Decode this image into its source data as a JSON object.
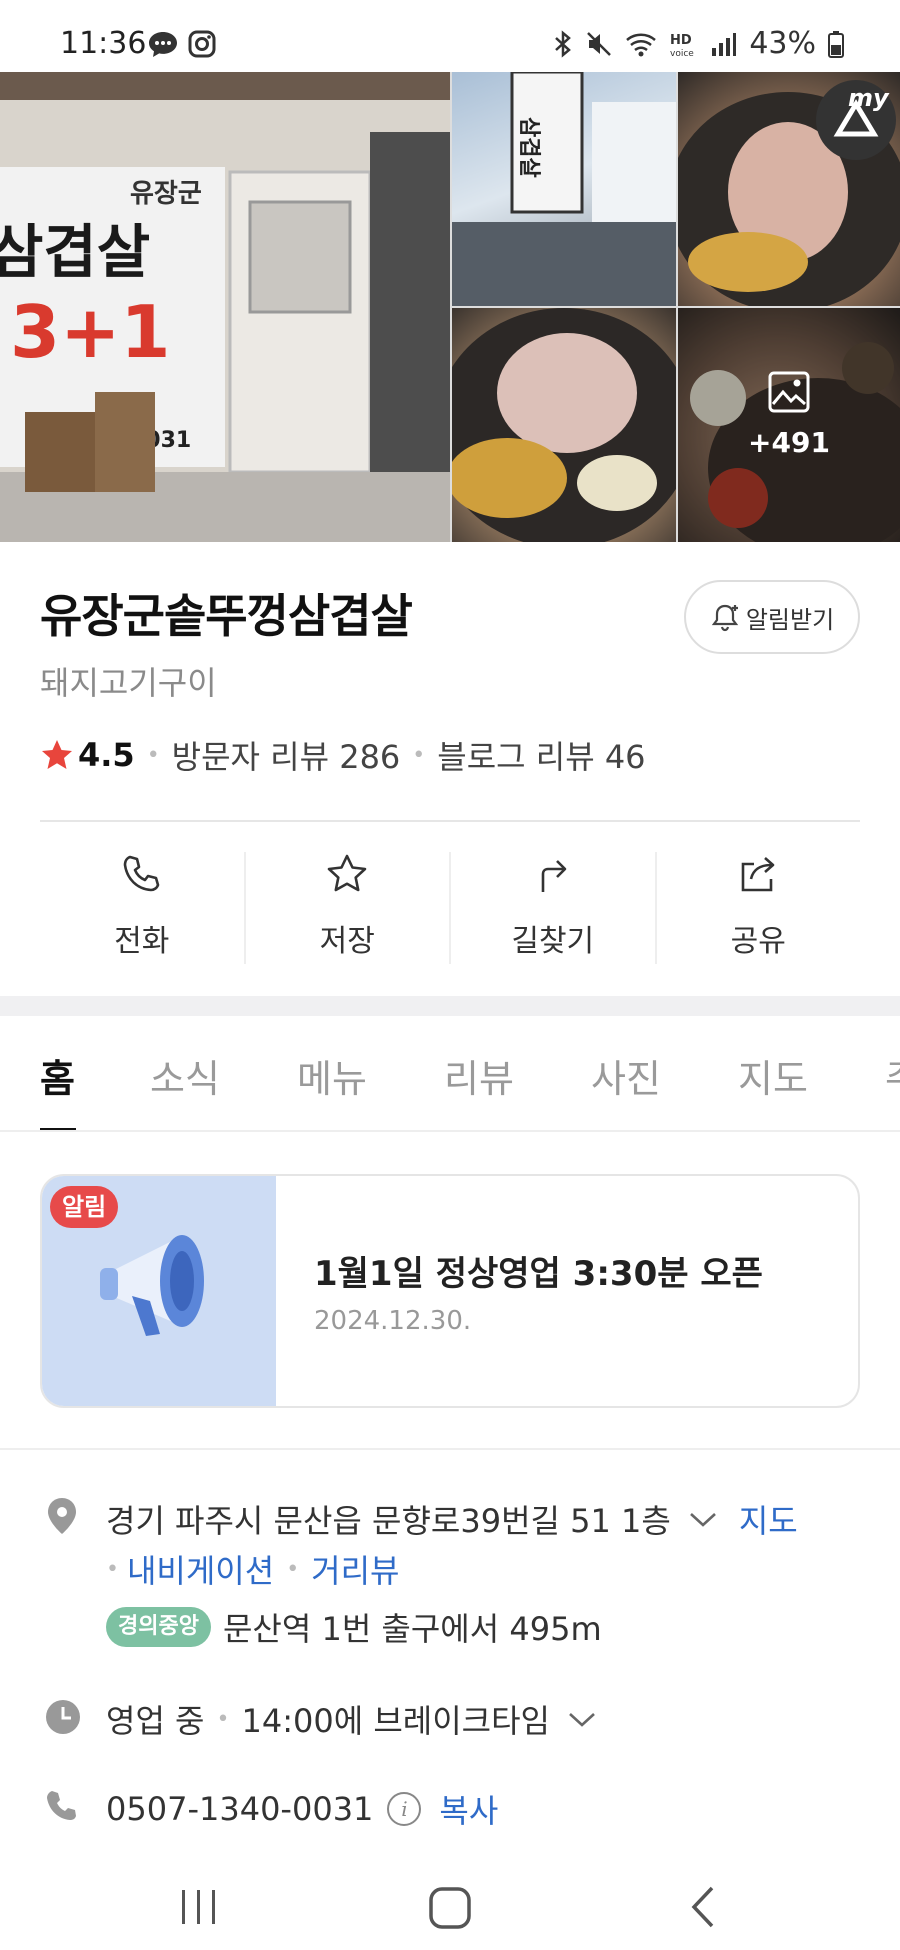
{
  "status_bar": {
    "time": "11:36",
    "battery": "43%",
    "left_icons": [
      "message-icon",
      "instagram-icon"
    ],
    "right_icons": [
      "bluetooth-icon",
      "mute-icon",
      "wifi-icon",
      "hd-voice-icon",
      "signal-icon",
      "battery-icon"
    ]
  },
  "gallery": {
    "main_sign_lines": [
      "유장군",
      "삼겹살",
      "3+1",
      "0031"
    ],
    "tile_sign": "삼겹살",
    "more_count": "+491",
    "badge_text": "my"
  },
  "shop": {
    "name": "유장군솥뚜껑삼겹살",
    "category": "돼지고기구이",
    "notify_label": "알림받기",
    "rating": "4.5",
    "visitor_reviews": "방문자 리뷰 286",
    "blog_reviews": "블로그 리뷰 46"
  },
  "actions": [
    {
      "label": "전화",
      "icon": "phone-icon"
    },
    {
      "label": "저장",
      "icon": "star-icon"
    },
    {
      "label": "길찾기",
      "icon": "directions-icon"
    },
    {
      "label": "공유",
      "icon": "share-icon"
    }
  ],
  "tabs": [
    "홈",
    "소식",
    "메뉴",
    "리뷰",
    "사진",
    "지도",
    "주"
  ],
  "active_tab": "홈",
  "notice": {
    "badge": "알림",
    "title": "1월1일 정상영업 3:30분 오픈",
    "date": "2024.12.30."
  },
  "info": {
    "address": "경기 파주시 문산읍 문향로39번길 51 1층",
    "map_link": "지도",
    "navigation_link": "내비게이션",
    "street_view_link": "거리뷰",
    "line_badge": "경의중앙",
    "station_distance": "문산역 1번 출구에서 495m",
    "status": "영업 중",
    "hours_note": "14:00에 브레이크타임",
    "phone": "0507-1340-0031",
    "copy_label": "복사"
  },
  "colors": {
    "star": "#e8453c",
    "link": "#2f6bc8",
    "notice_badge": "#e74a4a",
    "line_badge": "#7dc1a2",
    "notice_bg": "#cddcf4"
  }
}
